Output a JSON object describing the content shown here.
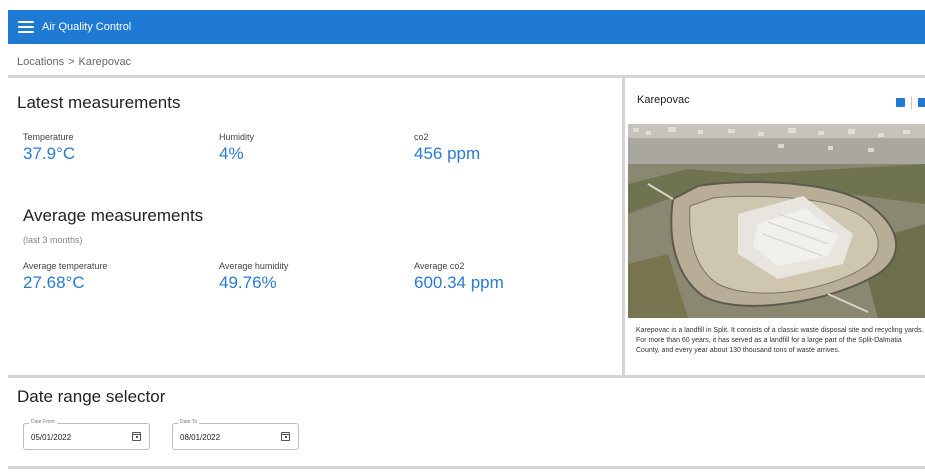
{
  "app": {
    "title": "Air Quality Control"
  },
  "breadcrumb": {
    "parent": "Locations",
    "separator": ">",
    "current": "Karepovac"
  },
  "latest": {
    "title": "Latest measurements",
    "temperature": {
      "label": "Temperature",
      "value": "37.9°C"
    },
    "humidity": {
      "label": "Humidity",
      "value": "4%"
    },
    "co2": {
      "label": "co2",
      "value": "456 ppm"
    }
  },
  "average": {
    "title": "Average measurements",
    "subtitle": "(last 3 months)",
    "temperature": {
      "label": "Average temperature",
      "value": "27.68°C"
    },
    "humidity": {
      "label": "Average humidity",
      "value": "49.76%"
    },
    "co2": {
      "label": "Average co2",
      "value": "600.34 ppm"
    }
  },
  "location": {
    "name": "Karepovac",
    "description": "Karepovac is a landfill in Split. It consists of a classic waste disposal site and recycling yards. For more than 60 years, it has served as a landfill for a large part of the Split-Dalmatia County, and every year about 130 thousand tons of waste arrives.",
    "icons": [
      "map-icon",
      "image-icon"
    ]
  },
  "date_range": {
    "title": "Date range selector",
    "from": {
      "label": "Date From",
      "value": "05/01/2022"
    },
    "to": {
      "label": "Date To",
      "value": "08/01/2022"
    }
  },
  "colors": {
    "appbar": "#1e7ad2",
    "value": "#2a7bd1",
    "divider": "#d4d4d4"
  }
}
